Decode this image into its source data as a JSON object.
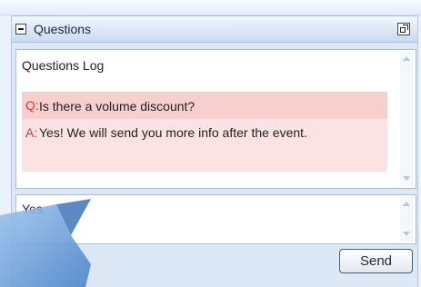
{
  "panel": {
    "title": "Questions"
  },
  "log": {
    "title": "Questions Log",
    "entries": [
      {
        "question_prefix": "Q:",
        "question": "Is there a volume discount?",
        "answer_prefix": "A:",
        "answer": "Yes! We will send you more info after the event."
      }
    ]
  },
  "input": {
    "value": "Yes"
  },
  "send_button": {
    "label": "Send"
  },
  "colors": {
    "panel_background": "#dce8f6",
    "question_highlight": "#f7cfcf",
    "answer_highlight": "#fbe3e3",
    "prefix_color": "#d23a3a",
    "pointer_arrow": "#6aa0dc"
  },
  "icons": {
    "collapse": "collapse-minus-icon",
    "popout": "popout-window-icon",
    "pointer": "pointer-arrow-graphic"
  }
}
